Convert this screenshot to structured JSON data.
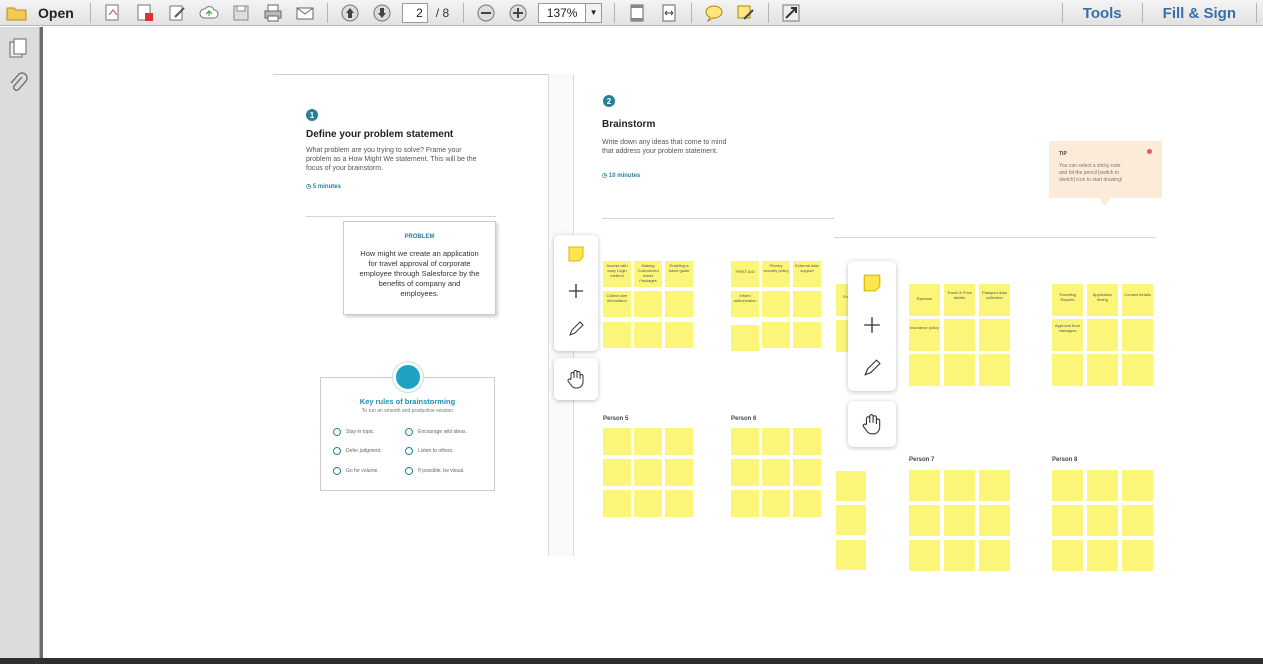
{
  "toolbar": {
    "open_label": "Open",
    "current_page": "2",
    "page_total": "/ 8",
    "zoom": "137%",
    "tools_label": "Tools",
    "fill_sign_label": "Fill & Sign"
  },
  "page1": {
    "step_number": "1",
    "title": "Define your problem statement",
    "description": [
      "What problem are you trying to solve? Frame your",
      "problem as a How Might We statement. This will be the",
      "focus of your brainstorm."
    ],
    "duration": "5 minutes",
    "problem_card": {
      "label": "PROBLEM",
      "text": [
        "How might we create an application",
        "for travel approval of corporate",
        "employee through Salesforce by the",
        "benefits of company and",
        "employees."
      ]
    },
    "rules_card": {
      "title": "Key rules of brainstorming",
      "subtitle": "To run an smooth and productive session",
      "rules": [
        "Stay in topic.",
        "Encourage wild ideas.",
        "Defer judgment.",
        "Listen to others.",
        "Go for volume.",
        "If possible, be visual."
      ]
    }
  },
  "page2": {
    "step_number": "2",
    "title": "Brainstorm",
    "description": [
      "Write down any ideas that come to mind",
      "that address your problem statement."
    ],
    "duration": "10 minutes",
    "tip": {
      "label": "TIP",
      "text": [
        "You can select a sticky note",
        "and hit the pencil [switch to",
        "sketch] icon to start drawing!"
      ]
    },
    "persons": [
      "Person 5",
      "Person 6",
      "Person 7",
      "Person 8"
    ],
    "notes": {
      "g1": [
        "Access with easy Login method",
        "Making Customized travel Packages",
        "Enabling a travel guide",
        "Collect user information"
      ],
      "g2": [
        "FIRST AID",
        "Privacy security policy",
        "External data support",
        "Inform authorization"
      ],
      "g3": [
        "Expense",
        "Travel & Price details",
        "Passport data collection",
        "Insurance policy"
      ],
      "g4": [
        "Travelling Reports",
        "Application timing",
        "Contact details",
        "Approval from managers"
      ]
    }
  },
  "colors": {
    "accent": "#2a7f97",
    "sticky": "#fbf57a",
    "link": "#3a6ea8"
  }
}
